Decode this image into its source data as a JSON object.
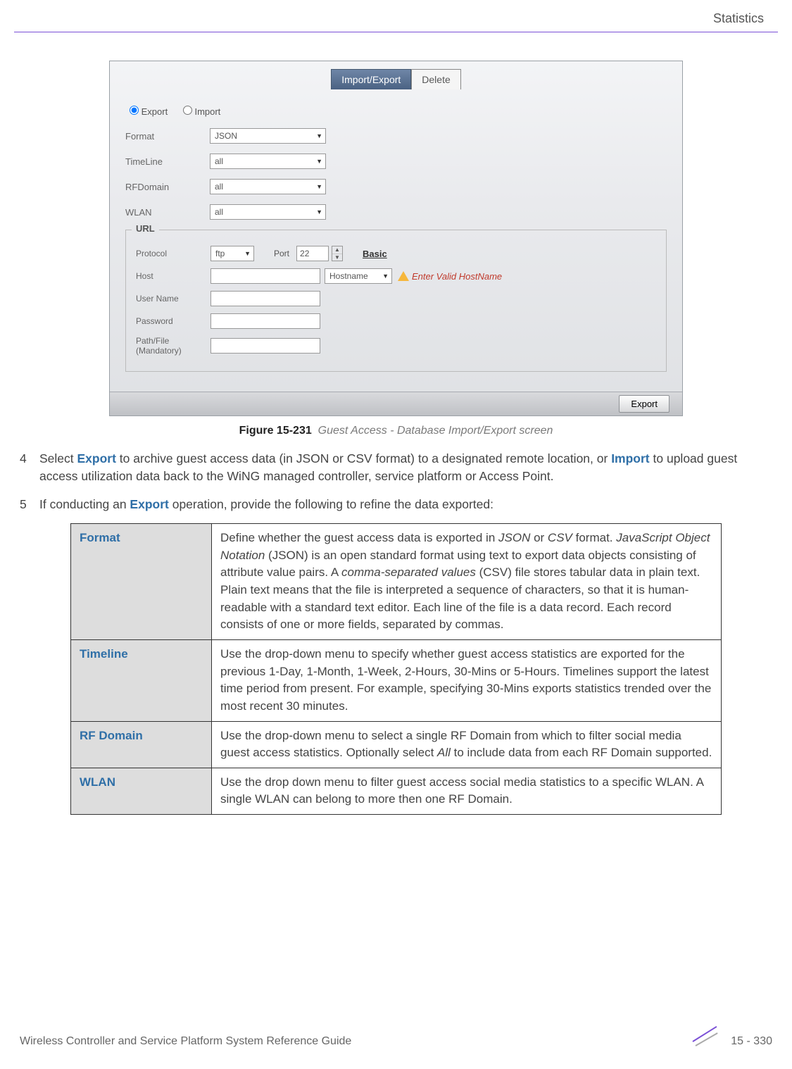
{
  "header": {
    "title": "Statistics"
  },
  "screenshot": {
    "tabs": {
      "active": "Import/Export",
      "inactive": "Delete"
    },
    "radios": {
      "export": "Export",
      "import": "Import"
    },
    "fields": {
      "format": {
        "label": "Format",
        "value": "JSON"
      },
      "timeline": {
        "label": "TimeLine",
        "value": "all"
      },
      "rfdomain": {
        "label": "RFDomain",
        "value": "all"
      },
      "wlan": {
        "label": "WLAN",
        "value": "all"
      }
    },
    "url": {
      "legend": "URL",
      "protocol_label": "Protocol",
      "protocol_value": "ftp",
      "port_label": "Port",
      "port_value": "22",
      "basic_link": "Basic",
      "host_label": "Host",
      "host_type": "Hostname",
      "warn": "Enter Valid HostName",
      "user_label": "User Name",
      "pass_label": "Password",
      "path_label": "Path/File (Mandatory)"
    },
    "footer_button": "Export"
  },
  "caption": {
    "prefix": "Figure 15-231",
    "text": "Guest Access - Database Import/Export screen"
  },
  "steps": {
    "s4_num": "4",
    "s4a": "Select ",
    "s4b": "Export",
    "s4c": " to archive guest access data (in JSON or CSV format) to a designated remote location, or ",
    "s4d": "Import",
    "s4e": " to upload guest access utilization data back to the WiNG managed controller, service platform or Access Point.",
    "s5_num": "5",
    "s5a": "If conducting an ",
    "s5b": "Export",
    "s5c": " operation, provide the following to refine the data exported:"
  },
  "table": {
    "r1": {
      "term": "Format",
      "d1": "Define whether the guest access data is exported in ",
      "i1": "JSON",
      "d2": " or ",
      "i2": "CSV",
      "d3": " format. ",
      "i3": "JavaScript Object Notation",
      "d4": " (JSON) is an open standard format using text to export data objects consisting of attribute value pairs. A ",
      "i4": "comma-separated values",
      "d5": " (CSV) file stores tabular data in plain text. Plain text means that the file is interpreted a sequence of characters, so that it is human-readable with a standard text editor. Each line of the file is a data record. Each record consists of one or more fields, separated by commas."
    },
    "r2": {
      "term": "Timeline",
      "desc": "Use the drop-down menu to specify whether guest access statistics are exported for the previous 1-Day, 1-Month, 1-Week, 2-Hours, 30-Mins or 5-Hours. Timelines support the latest time period from present. For example, specifying 30-Mins exports statistics trended over the most recent 30 minutes."
    },
    "r3": {
      "term": "RF Domain",
      "d1": "Use the drop-down menu to select a single RF Domain from which to filter social media guest access statistics. Optionally select ",
      "i1": "All",
      "d2": " to include data from each RF Domain supported."
    },
    "r4": {
      "term": "WLAN",
      "desc": "Use the drop down menu to filter guest access social media statistics to a specific WLAN. A single WLAN can belong to more then one RF Domain."
    }
  },
  "footer": {
    "left": "Wireless Controller and Service Platform System Reference Guide",
    "right": "15 - 330"
  }
}
